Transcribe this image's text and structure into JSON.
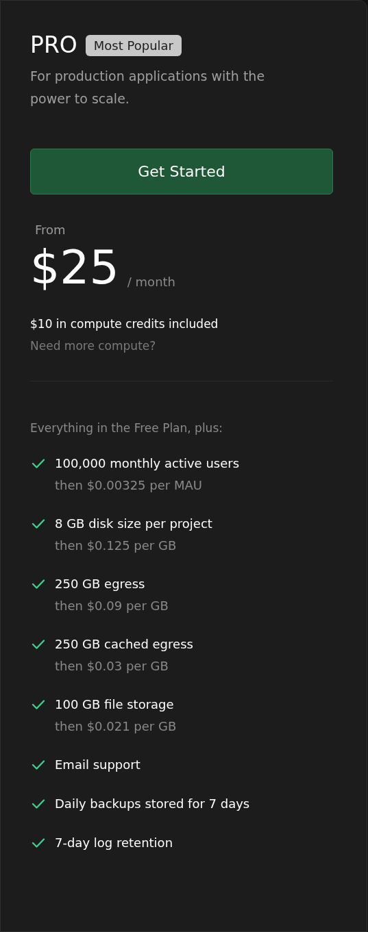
{
  "plan": {
    "name": "PRO",
    "badge": "Most Popular",
    "description": "For production applications with the power to scale."
  },
  "cta": {
    "label": "Get Started"
  },
  "price": {
    "prefix": "From",
    "amount": "$25",
    "period": "/ month",
    "note": "$10 in compute credits included",
    "link": "Need more compute?"
  },
  "features_heading": "Everything in the Free Plan, plus:",
  "features": [
    {
      "title": "100,000 monthly active users",
      "detail": "then $0.00325 per MAU"
    },
    {
      "title": "8 GB disk size per project",
      "detail": "then $0.125 per GB"
    },
    {
      "title": "250 GB egress",
      "detail": "then $0.09 per GB"
    },
    {
      "title": "250 GB cached egress",
      "detail": "then $0.03 per GB"
    },
    {
      "title": "100 GB file storage",
      "detail": "then $0.021 per GB"
    },
    {
      "title": "Email support"
    },
    {
      "title": "Daily backups stored for 7 days"
    },
    {
      "title": "7-day log retention"
    }
  ]
}
